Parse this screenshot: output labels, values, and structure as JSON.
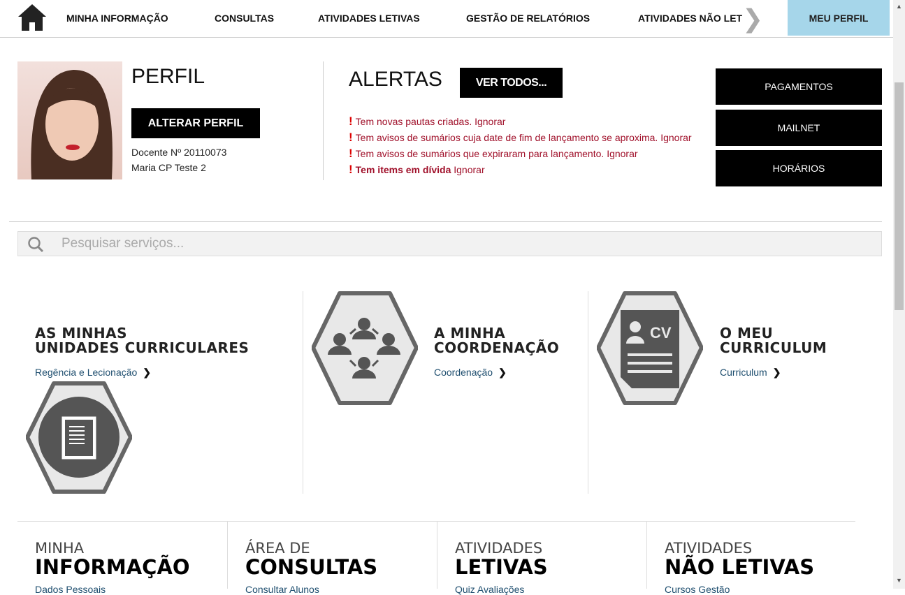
{
  "nav": {
    "items": [
      "MINHA INFORMAÇÃO",
      "CONSULTAS",
      "ATIVIDADES LETIVAS",
      "GESTÃO DE RELATÓRIOS",
      "ATIVIDADES NÃO LET"
    ],
    "profile": "MEU PERFIL"
  },
  "profile": {
    "title": "PERFIL",
    "change_button": "ALTERAR PERFIL",
    "number": "Docente Nº 20110073",
    "name": "Maria CP Teste 2"
  },
  "alerts": {
    "title": "ALERTAS",
    "see_all": "VER TODOS...",
    "items": [
      {
        "text": "Tem novas pautas criadas.",
        "action": "Ignorar",
        "bold": false
      },
      {
        "text": "Tem avisos de sumários cuja date de fim de lançamento se aproxima.",
        "action": "Ignorar",
        "bold": false
      },
      {
        "text": "Tem avisos de sumários que expiraram para lançamento.",
        "action": "Ignorar",
        "bold": false
      },
      {
        "text": "Tem items em dívida",
        "action": "Ignorar",
        "bold": true
      }
    ]
  },
  "quick": [
    "PAGAMENTOS",
    "MAILNET",
    "HORÁRIOS"
  ],
  "search": {
    "placeholder": "Pesquisar serviços..."
  },
  "cards": [
    {
      "line1": "AS MINHAS",
      "line2": "UNIDADES CURRICULARES",
      "link": "Regência e Lecionação"
    },
    {
      "line1": "A MINHA",
      "line2": "COORDENAÇÃO",
      "link": "Coordenação"
    },
    {
      "line1": "O MEU",
      "line2": "CURRICULUM",
      "link": "Curriculum",
      "icon_text": "CV"
    }
  ],
  "sections": [
    {
      "line1": "MINHA",
      "line2": "INFORMAÇÃO",
      "link": "Dados Pessoais"
    },
    {
      "line1": "ÁREA DE",
      "line2": "CONSULTAS",
      "link": "Consultar Alunos"
    },
    {
      "line1": "ATIVIDADES",
      "line2": "LETIVAS",
      "link": "Quiz Avaliações"
    },
    {
      "line1": "ATIVIDADES",
      "line2": "NÃO LETIVAS",
      "link": "Cursos Gestão"
    }
  ]
}
